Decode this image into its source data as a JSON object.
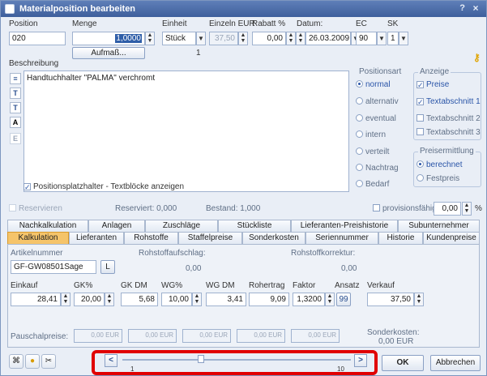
{
  "window": {
    "title": "Materialposition bearbeiten",
    "help": "?",
    "close": "×"
  },
  "header": {
    "position_label": "Position",
    "position_value": "020",
    "menge_label": "Menge",
    "menge_value": "1,0000",
    "aufmass_label": "Aufmaß...",
    "einheit_label": "Einheit",
    "einheit_value": "Stück",
    "einzel_label": "Einzeln EUR",
    "einzel_value": "37,50",
    "rabatt_label": "Rabatt %",
    "rabatt_value": "0,00",
    "datum_label": "Datum:",
    "datum_value": "26.03.2009",
    "ec_label": "EC",
    "ec_value": "90",
    "sk_label": "SK",
    "sk_value": "1",
    "counter": "1"
  },
  "beschreibung": {
    "label": "Beschreibung",
    "text": "Handtuchhalter \"PALMA\" verchromt",
    "toolbar": [
      "A",
      "E"
    ],
    "platzhalter_label": "Positionsplatzhalter - Textblöcke anzeigen"
  },
  "positionsart": {
    "title": "Positionsart",
    "options": [
      "normal",
      "alternativ",
      "eventual",
      "intern",
      "verteilt",
      "Nachtrag",
      "Bedarf"
    ],
    "selected": "normal"
  },
  "anzeige": {
    "title": "Anzeige",
    "options": [
      "Preise",
      "Textabschnitt 1",
      "Textabschnitt 2",
      "Textabschnitt 3"
    ],
    "checked": [
      "Preise",
      "Textabschnitt 1"
    ]
  },
  "preisermittlung": {
    "title": "Preisermittlung",
    "options": [
      "berechnet",
      "Festpreis"
    ],
    "selected": "berechnet"
  },
  "status": {
    "reservieren": "Reservieren",
    "reserviert": "Reserviert: 0,000",
    "bestand": "Bestand: 1,000",
    "provisionsfaehig": "provisionsfähig",
    "prov_value": "0,00",
    "prov_unit": "%"
  },
  "tabs_row1": [
    "Nachkalkulation",
    "Anlagen",
    "Zuschläge",
    "Stückliste",
    "Lieferanten-Preishistorie",
    "Subunternehmer"
  ],
  "tabs_row2": [
    "Kalkulation",
    "Lieferanten",
    "Rohstoffe",
    "Staffelpreise",
    "Sonderkosten",
    "Seriennummer",
    "Historie",
    "Kundenpreise"
  ],
  "active_tab": "Kalkulation",
  "kalkulation": {
    "artikelnummer_label": "Artikelnummer",
    "artikelnummer_value": "GF-GW08501Sage",
    "l_button": "L",
    "rohstoffaufschlag_label": "Rohstoffaufschlag:",
    "rohstoffaufschlag_value": "0,00",
    "rohstoffkorrektur_label": "Rohstoffkorrektur:",
    "rohstoffkorrektur_value": "0,00",
    "cols": [
      "Einkauf",
      "GK%",
      "GK DM",
      "WG%",
      "WG DM",
      "Rohertrag",
      "Faktor",
      "Ansatz",
      "Verkauf"
    ],
    "einkauf": "28,41",
    "gk_pct": "20,00",
    "gk_dm": "5,68",
    "wg_pct": "10,00",
    "wg_dm": "3,41",
    "rohertrag": "9,09",
    "faktor": "1,3200",
    "ansatz": "99",
    "verkauf": "37,50",
    "pauschalpreise_label": "Pauschalpreise:",
    "pauschalpreise": [
      "0,00 EUR",
      "0,00 EUR",
      "0,00 EUR",
      "0,00 EUR",
      "0,00 EUR"
    ],
    "sonderkosten_label": "Sonderkosten:",
    "sonderkosten_value": "0,00 EUR"
  },
  "footer": {
    "slider_min": "1",
    "slider_max": "10",
    "prev": "<",
    "next": ">",
    "ok": "OK",
    "abbrechen": "Abbrechen"
  }
}
